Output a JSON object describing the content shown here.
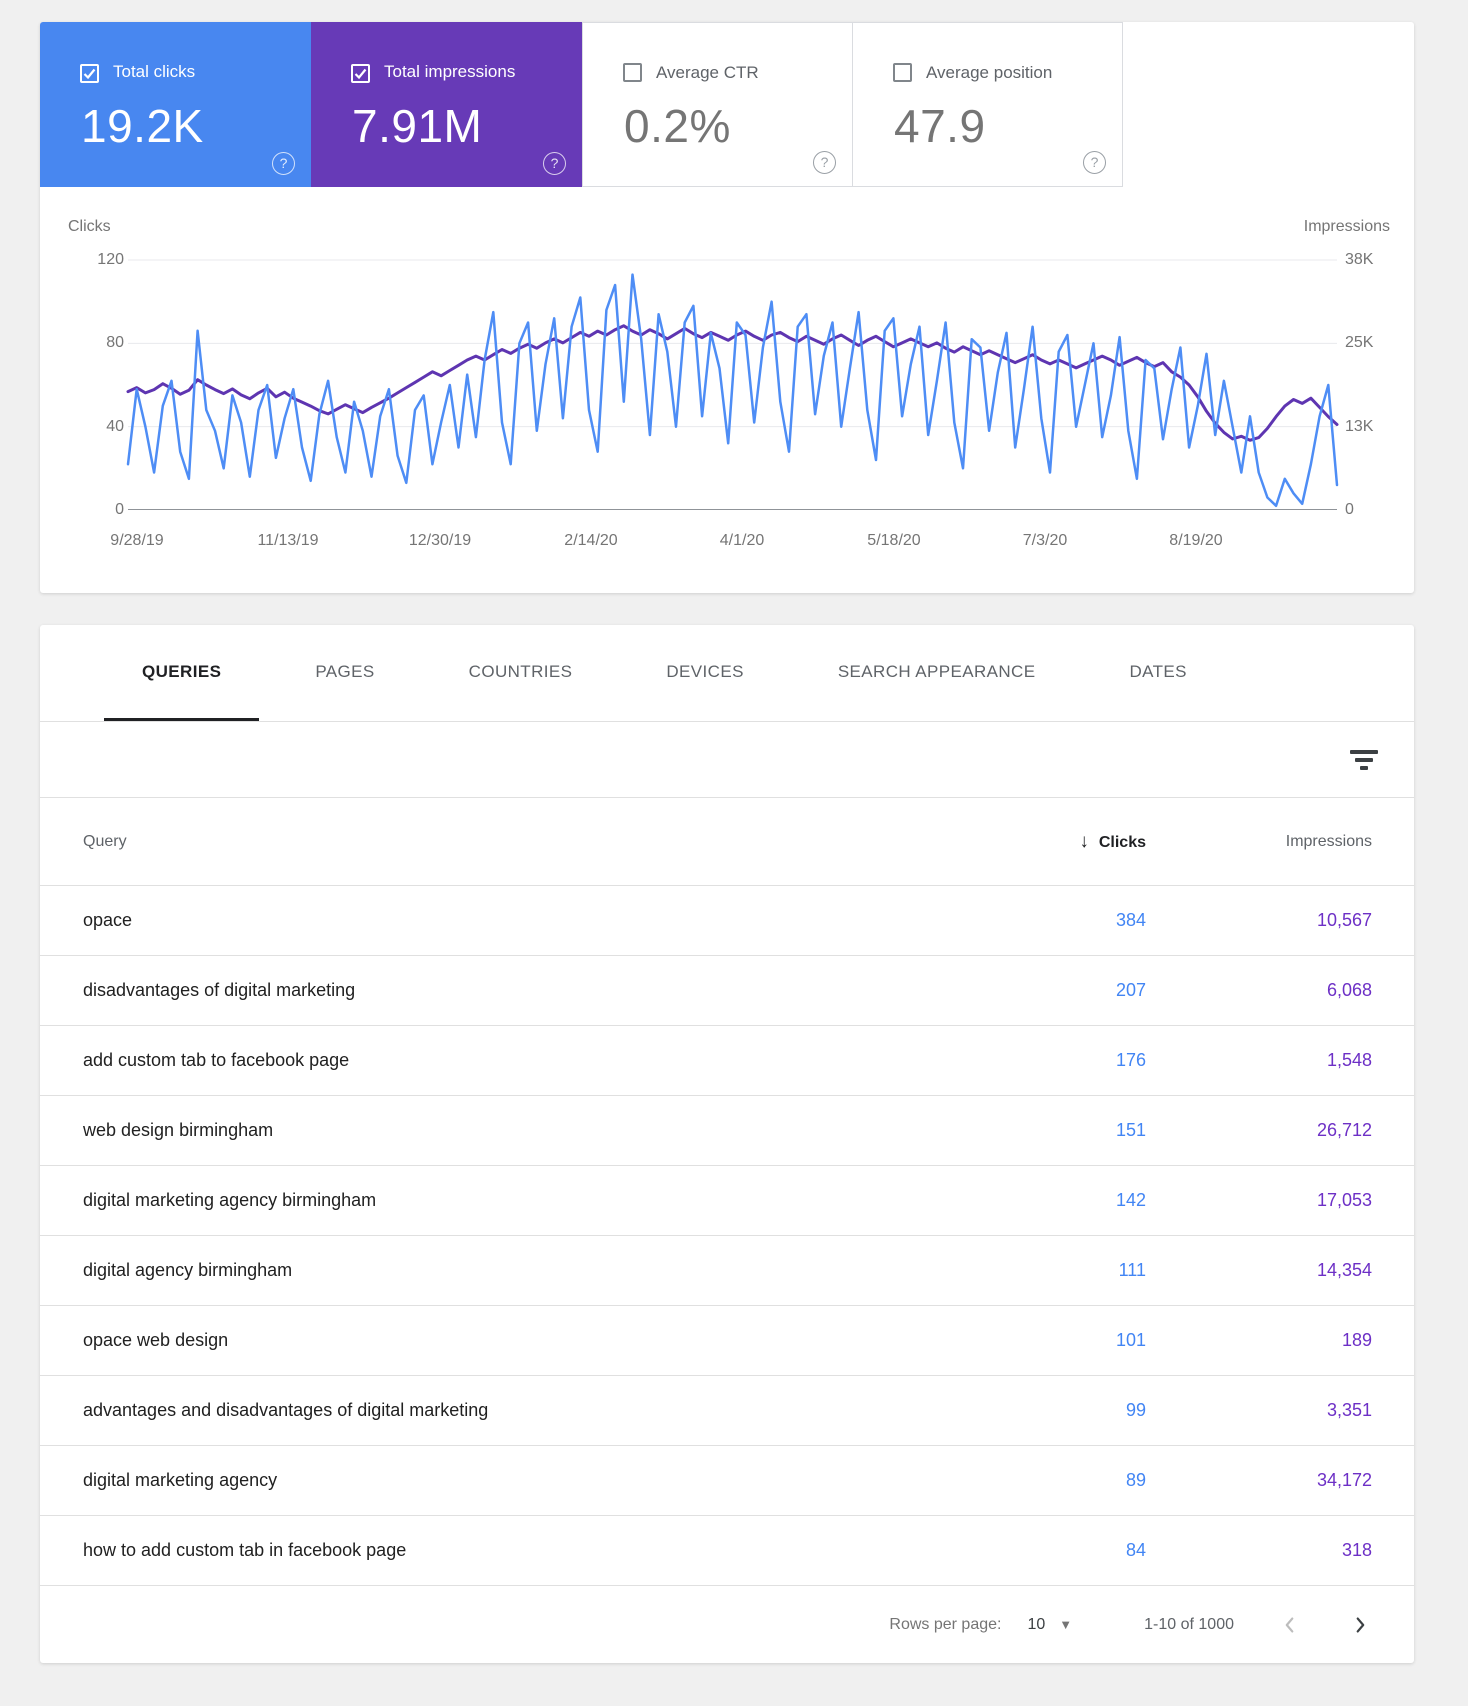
{
  "colors": {
    "clicks_blue": "#4887f0",
    "impressions_purple": "#673ab7",
    "line_blue": "#4e8df5",
    "line_purple": "#5e35b1",
    "table_clicks": "#4285f4",
    "table_impressions": "#6d30c6"
  },
  "cards": [
    {
      "label": "Total clicks",
      "value": "19.2K",
      "checked": true
    },
    {
      "label": "Total impressions",
      "value": "7.91M",
      "checked": true
    },
    {
      "label": "Average CTR",
      "value": "0.2%",
      "checked": false
    },
    {
      "label": "Average position",
      "value": "47.9",
      "checked": false
    }
  ],
  "icons": {
    "help": "?",
    "sort_desc": "↓",
    "dropdown": "▼"
  },
  "chart_data": {
    "type": "line",
    "left_axis": {
      "title": "Clicks",
      "range": [
        0,
        120
      ],
      "ticks": [
        "120",
        "80",
        "40",
        "0"
      ]
    },
    "right_axis": {
      "title": "Impressions",
      "range": [
        0,
        38000
      ],
      "ticks": [
        "38K",
        "25K",
        "13K",
        "0"
      ]
    },
    "x_ticks": [
      "9/28/19",
      "11/13/19",
      "12/30/19",
      "2/14/20",
      "4/1/20",
      "5/18/20",
      "7/3/20",
      "8/19/20"
    ],
    "grid": true,
    "legend_position": "none",
    "series": [
      {
        "name": "Clicks",
        "axis": "left",
        "color": "#4e8df5",
        "values": [
          22,
          58,
          40,
          18,
          50,
          62,
          28,
          15,
          86,
          48,
          38,
          20,
          55,
          42,
          16,
          48,
          60,
          25,
          44,
          58,
          30,
          14,
          46,
          62,
          35,
          18,
          52,
          38,
          16,
          45,
          58,
          26,
          13,
          48,
          55,
          22,
          42,
          60,
          30,
          65,
          35,
          72,
          95,
          42,
          22,
          80,
          90,
          38,
          70,
          92,
          44,
          88,
          102,
          48,
          28,
          96,
          108,
          52,
          113,
          82,
          36,
          94,
          76,
          40,
          90,
          98,
          45,
          85,
          68,
          32,
          90,
          84,
          42,
          78,
          100,
          52,
          28,
          88,
          94,
          46,
          74,
          90,
          40,
          68,
          95,
          48,
          24,
          86,
          92,
          45,
          70,
          88,
          36,
          62,
          90,
          42,
          20,
          82,
          78,
          38,
          66,
          85,
          30,
          58,
          88,
          44,
          18,
          76,
          84,
          40,
          60,
          80,
          35,
          55,
          83,
          38,
          15,
          72,
          68,
          34,
          58,
          78,
          30,
          50,
          75,
          36,
          62,
          40,
          18,
          45,
          18,
          6,
          2,
          15,
          8,
          3,
          22,
          45,
          60,
          12
        ]
      },
      {
        "name": "Impressions",
        "axis": "right",
        "color": "#5e35b1",
        "values": [
          18000,
          18600,
          17800,
          18300,
          19200,
          18500,
          17600,
          18200,
          19800,
          19000,
          18300,
          17700,
          18400,
          17500,
          16900,
          17800,
          18500,
          17200,
          17900,
          17000,
          16400,
          15800,
          15100,
          14600,
          15300,
          16000,
          15400,
          14800,
          15600,
          16300,
          17000,
          17800,
          18600,
          19400,
          20200,
          21000,
          20400,
          21200,
          22000,
          22800,
          23400,
          22800,
          23600,
          24400,
          23800,
          24600,
          25200,
          24600,
          25400,
          26000,
          25400,
          26200,
          27000,
          26400,
          27200,
          26600,
          27400,
          28000,
          27200,
          26600,
          27400,
          26800,
          26000,
          26800,
          27600,
          26800,
          26200,
          27000,
          26400,
          25800,
          26600,
          27200,
          26400,
          25800,
          26600,
          27000,
          26200,
          25600,
          26400,
          25800,
          25200,
          26000,
          26600,
          25800,
          25000,
          25800,
          26400,
          25600,
          24800,
          25400,
          26000,
          25400,
          24800,
          25400,
          24600,
          24000,
          24800,
          24200,
          23600,
          24200,
          23600,
          23000,
          22400,
          23000,
          23600,
          22800,
          22200,
          22800,
          22200,
          21600,
          22200,
          22800,
          23400,
          22800,
          22000,
          22600,
          23200,
          22400,
          21800,
          22400,
          21000,
          20200,
          19000,
          17200,
          15000,
          13200,
          11800,
          10800,
          11200,
          10600,
          11000,
          12400,
          14200,
          15800,
          16800,
          16200,
          17000,
          15600,
          14200,
          13000
        ]
      }
    ]
  },
  "tabs": [
    {
      "label": "QUERIES",
      "active": true
    },
    {
      "label": "PAGES",
      "active": false
    },
    {
      "label": "COUNTRIES",
      "active": false
    },
    {
      "label": "DEVICES",
      "active": false
    },
    {
      "label": "SEARCH APPEARANCE",
      "active": false
    },
    {
      "label": "DATES",
      "active": false
    }
  ],
  "table": {
    "headers": {
      "query": "Query",
      "clicks": "Clicks",
      "impressions": "Impressions"
    },
    "sort_column": "Clicks",
    "sort_direction": "desc",
    "rows": [
      {
        "query": "opace",
        "clicks": "384",
        "impressions": "10,567"
      },
      {
        "query": "disadvantages of digital marketing",
        "clicks": "207",
        "impressions": "6,068"
      },
      {
        "query": "add custom tab to facebook page",
        "clicks": "176",
        "impressions": "1,548"
      },
      {
        "query": "web design birmingham",
        "clicks": "151",
        "impressions": "26,712"
      },
      {
        "query": "digital marketing agency birmingham",
        "clicks": "142",
        "impressions": "17,053"
      },
      {
        "query": "digital agency birmingham",
        "clicks": "111",
        "impressions": "14,354"
      },
      {
        "query": "opace web design",
        "clicks": "101",
        "impressions": "189"
      },
      {
        "query": "advantages and disadvantages of digital marketing",
        "clicks": "99",
        "impressions": "3,351"
      },
      {
        "query": "digital marketing agency",
        "clicks": "89",
        "impressions": "34,172"
      },
      {
        "query": "how to add custom tab in facebook page",
        "clicks": "84",
        "impressions": "318"
      }
    ]
  },
  "pagination": {
    "rows_per_page_label": "Rows per page:",
    "rows_per_page": "10",
    "range": "1-10 of 1000"
  }
}
